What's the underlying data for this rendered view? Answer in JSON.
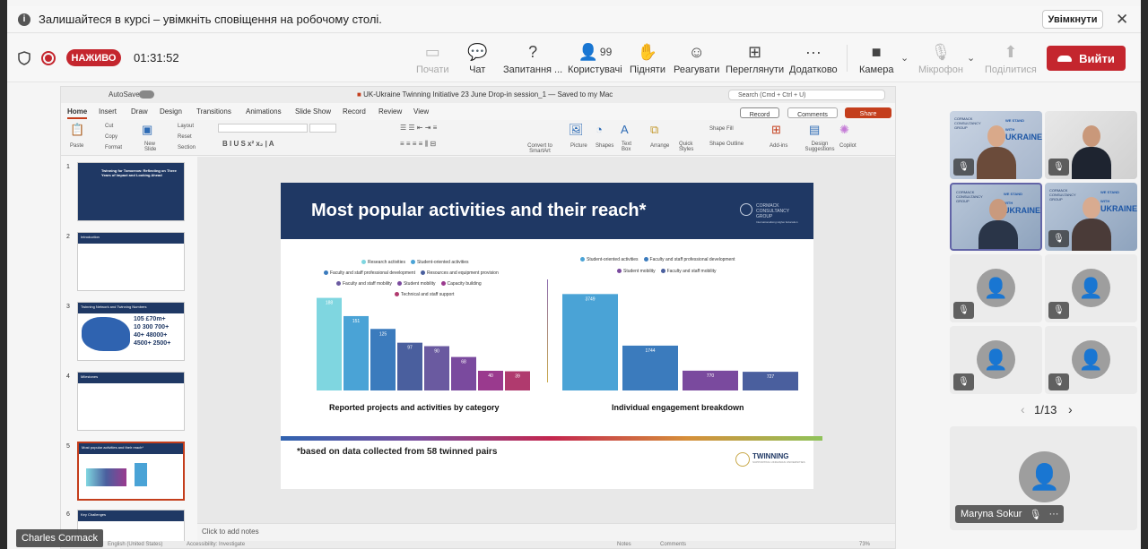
{
  "notification": {
    "text": "Залишайтеся в курсі – увімкніть сповіщення на робочому столі.",
    "enable_label": "Увімкнути"
  },
  "meeting": {
    "live_label": "НАЖИВО",
    "timer": "01:31:52"
  },
  "toolbar": {
    "start": "Почати",
    "chat": "Чат",
    "qa": "Запитання ...",
    "participants": "Користувачі",
    "participants_count": "99",
    "raise": "Підняти",
    "react": "Реагувати",
    "view": "Переглянути",
    "more": "Додатково",
    "camera": "Камера",
    "mic": "Мікрофон",
    "share": "Поділитися",
    "leave": "Вийти"
  },
  "ppt": {
    "autosave": "AutoSave",
    "doc_title": "UK-Ukraine Twinning Initiative 23 June Drop-in session_1",
    "saved": "— Saved to my Mac",
    "search": "Search (Cmd + Ctrl + U)",
    "tabs": [
      "Home",
      "Insert",
      "Draw",
      "Design",
      "Transitions",
      "Animations",
      "Slide Show",
      "Record",
      "Review",
      "View"
    ],
    "record_btn": "Record",
    "comments_btn": "Comments",
    "share_btn": "Share",
    "ribbon": {
      "paste": "Paste",
      "cut": "Cut",
      "copy": "Copy",
      "format": "Format",
      "new_slide": "New Slide",
      "layout": "Layout",
      "reset": "Reset",
      "section": "Section",
      "convert": "Convert to SmartArt",
      "picture": "Picture",
      "shapes": "Shapes",
      "textbox": "Text Box",
      "arrange": "Arrange",
      "quick_styles": "Quick Styles",
      "shape_fill": "Shape Fill",
      "shape_outline": "Shape Outline",
      "addins": "Add-ins",
      "design_sugg": "Design Suggestions",
      "copilot": "Copilot"
    },
    "notes_placeholder": "Click to add notes",
    "status": {
      "lang": "English (United States)",
      "access": "Accessibility: Investigate",
      "notes": "Notes",
      "comments": "Comments",
      "zoom": "73%"
    }
  },
  "thumbs": [
    {
      "num": "1",
      "title": "Twinning for Tomorrow: Reflecting on Three Years of Impact and Looking Ahead"
    },
    {
      "num": "2",
      "title": "Introduction"
    },
    {
      "num": "3",
      "title": "Twinning Network and Twinning Numbers",
      "stats": [
        "105",
        "£70m+",
        "10",
        "300",
        "700+",
        "40+",
        "48000+",
        "4500+",
        "2500+"
      ]
    },
    {
      "num": "4",
      "title": "Milestones"
    },
    {
      "num": "5",
      "title": "Most popular activities and their reach*"
    },
    {
      "num": "6",
      "title": "Key Challenges"
    }
  ],
  "slide": {
    "title": "Most popular activities and their reach*",
    "brand": [
      "CORMACK",
      "CONSULTANCY",
      "GROUP"
    ],
    "brand_sub": "Internationalising Higher Education",
    "footnote": "*based on data collected from 58 twinned pairs",
    "twinning": "TWINNING",
    "twinning_sub": "SUPPORTING UKRAINIAN UNIVERSITIES"
  },
  "chart_data": [
    {
      "type": "bar",
      "title": "Reported projects and activities by category",
      "categories": [
        "Research activities",
        "Student-oriented activities",
        "Faculty and staff professional development",
        "Resources and equipment provision",
        "Faculty and staff mobility",
        "Student mobility",
        "Capacity building",
        "Technical and staff support"
      ],
      "values": [
        188,
        151,
        125,
        97,
        90,
        68,
        40,
        39
      ],
      "colors": [
        "#7fd6e0",
        "#4aa3d6",
        "#3b7bbd",
        "#4a5f9e",
        "#6a5aa0",
        "#7a4a9e",
        "#9a3a8e",
        "#b03a6e"
      ]
    },
    {
      "type": "bar",
      "title": "Individual engagement breakdown",
      "categories": [
        "Student-oriented activities",
        "Faculty and staff professional development",
        "Student mobility",
        "Faculty and staff mobility"
      ],
      "values": [
        3749,
        1744,
        770,
        727
      ],
      "colors": [
        "#4aa3d6",
        "#3b7bbd",
        "#7a4a9e",
        "#4a5f9e"
      ]
    }
  ],
  "participants": {
    "page": "1/13",
    "main_name": "Maryna Sokur",
    "ukraine": [
      "WE STAND",
      "WITH",
      "UKRAINE"
    ],
    "cormack": [
      "CORMACK",
      "CONSULTANCY",
      "GROUP"
    ]
  },
  "caption": "Charles Cormack",
  "colors": {
    "accent": "#c4262e",
    "ppt_accent": "#c43e1c",
    "slide_header": "#1f3864",
    "teams": "#6264a7"
  }
}
